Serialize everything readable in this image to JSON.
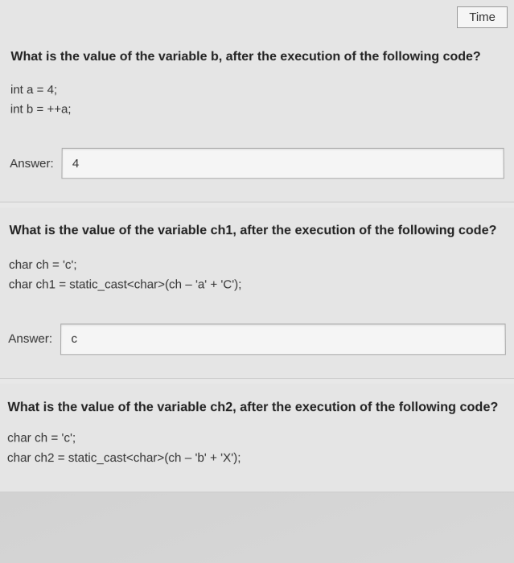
{
  "header": {
    "time_label": "Time"
  },
  "questions": [
    {
      "prompt": "What is the value of the variable b, after the execution of the following code?",
      "code_lines": [
        "int a = 4;",
        "int b = ++a;"
      ],
      "answer_label": "Answer:",
      "answer_value": "4"
    },
    {
      "prompt": "What is the value of the variable ch1, after the execution of the following code?",
      "code_lines": [
        "char ch = 'c';",
        "char ch1 = static_cast<char>(ch – 'a' + 'C');"
      ],
      "answer_label": "Answer:",
      "answer_value": "c"
    },
    {
      "prompt": "What is the value of the variable ch2, after the execution of the following code?",
      "code_lines": [
        "char ch = 'c';",
        "char ch2 = static_cast<char>(ch – 'b' + 'X');"
      ],
      "answer_label": "Answer:",
      "answer_value": ""
    }
  ]
}
